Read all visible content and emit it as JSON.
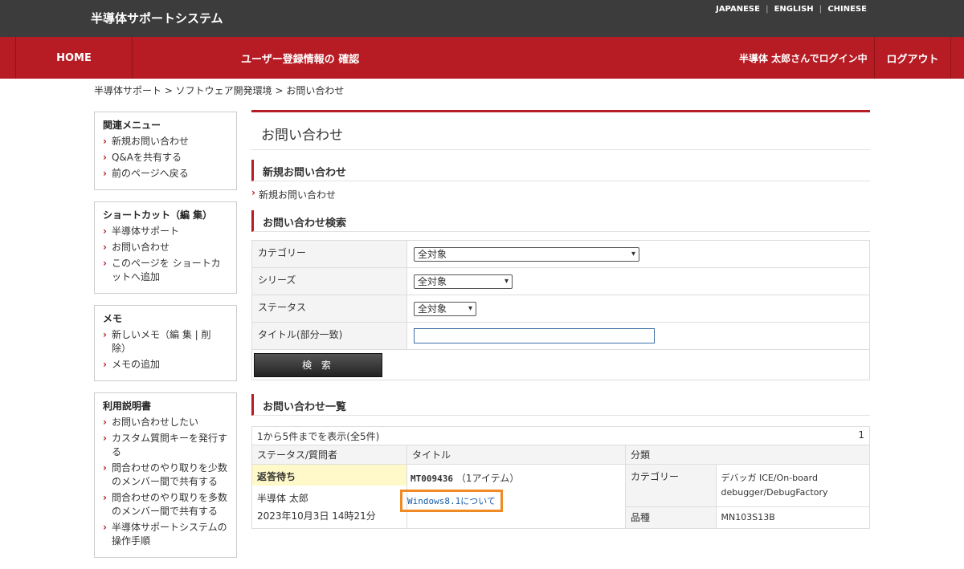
{
  "header": {
    "site_title": "半導体サポートシステム",
    "languages": [
      "JAPANESE",
      "ENGLISH",
      "CHINESE"
    ]
  },
  "nav": {
    "home": "HOME",
    "confirm": "ユーザー登録情報の 確認",
    "user_status": "半導体 太郎さんでログイン中",
    "logout": "ログアウト"
  },
  "breadcrumb": "半導体サポート > ソフトウェア開発環境 > お問い合わせ",
  "sidebar": {
    "related": {
      "title": "関連メニュー",
      "items": [
        "新規お問い合わせ",
        "Q&Aを共有する",
        "前のページへ戻る"
      ]
    },
    "shortcut": {
      "title": "ショートカット（編 集）",
      "items": [
        "半導体サポート",
        "お問い合わせ",
        "このページを ショートカットへ追加"
      ]
    },
    "memo": {
      "title": "メモ",
      "items": [
        "新しいメモ（編 集 | 削 除）",
        "メモの追加"
      ]
    },
    "manual": {
      "title": "利用説明書",
      "items": [
        "お問い合わせしたい",
        "カスタム質問キーを発行する",
        "問合わせのやり取りを少数のメンバー間で共有する",
        "問合わせのやり取りを多数のメンバー間で共有する",
        "半導体サポートシステムの操作手順"
      ]
    }
  },
  "main": {
    "page_title": "お問い合わせ",
    "new_section": {
      "title": "新規お問い合わせ",
      "link": "新規お問い合わせ"
    },
    "search_section": {
      "title": "お問い合わせ検索",
      "fields": [
        {
          "label": "カテゴリー",
          "value": "全対象"
        },
        {
          "label": "シリーズ",
          "value": "全対象"
        },
        {
          "label": "ステータス",
          "value": "全対象"
        },
        {
          "label": "タイトル(部分一致)",
          "value": ""
        }
      ],
      "button": "検 索"
    },
    "list_section": {
      "title": "お問い合わせ一覧",
      "summary": "1から5件までを表示(全5件)",
      "page": "1",
      "columns": [
        "ステータス/質問者",
        "タイトル",
        "分類"
      ],
      "row": {
        "status": "返答待ち",
        "asker": "半導体 太郎",
        "date": "2023年10月3日 14時21分",
        "ticket": "MT009436",
        "items": "（1アイテム）",
        "title": "Windows8.1について",
        "class_label_1": "カテゴリー",
        "class_value_1": "デバッガ ICE/On-board debugger/DebugFactory",
        "class_label_2": "品種",
        "class_value_2": "MN103S13B"
      }
    }
  },
  "colors": {
    "brand_red": "#b71c24",
    "topbar": "#3c3c3c",
    "highlight": "#f08a24"
  }
}
